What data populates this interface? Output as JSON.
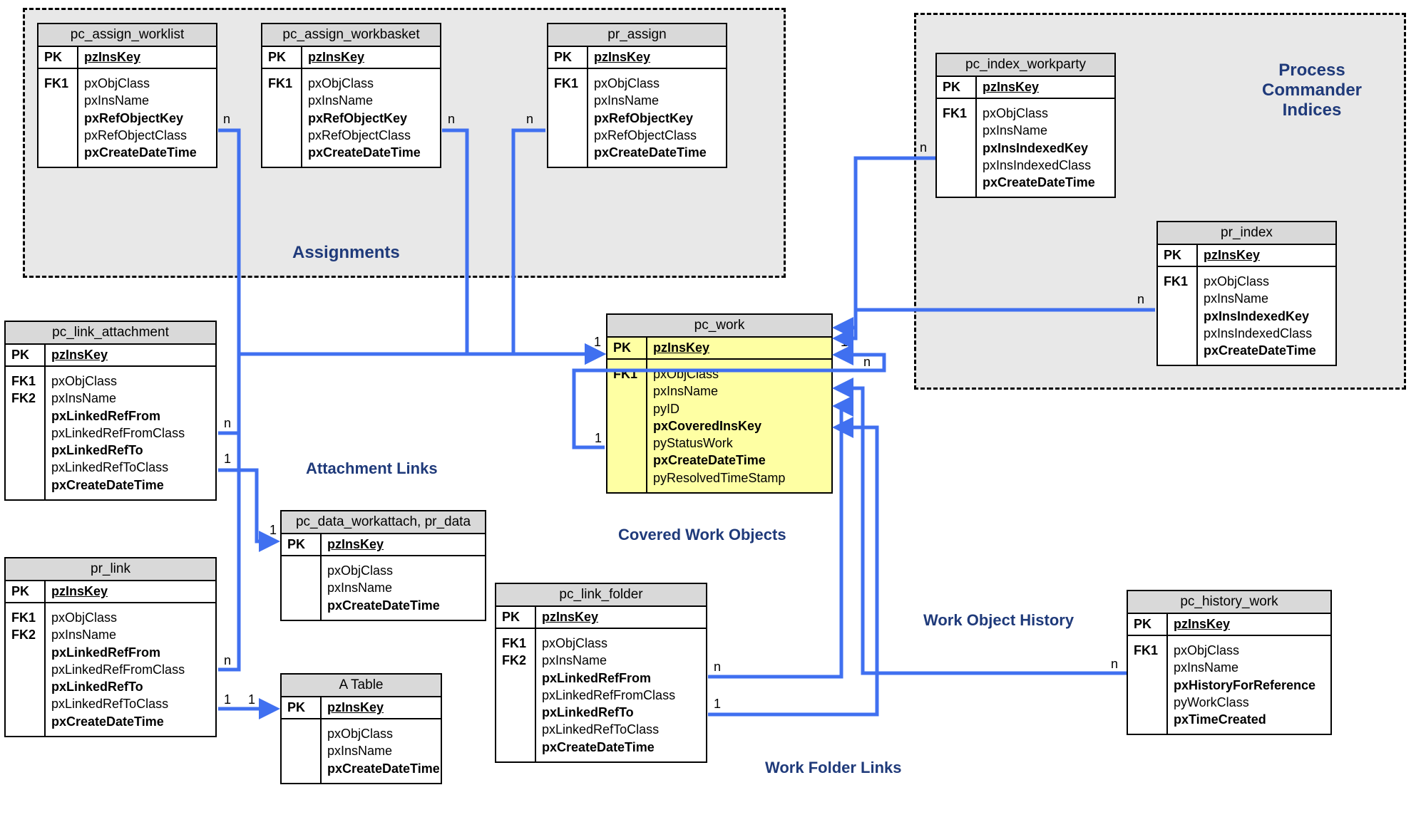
{
  "groups": {
    "assignments_label": "Assignments",
    "indices_label_l1": "Process Commander",
    "indices_label_l2": "Indices"
  },
  "labels": {
    "attachment_links": "Attachment Links",
    "covered_work_objects": "Covered Work Objects",
    "work_object_history": "Work Object History",
    "work_folder_links": "Work Folder Links"
  },
  "entities": {
    "pc_assign_worklist": {
      "title": "pc_assign_worklist",
      "pk": "pzInsKey",
      "keys": "\n\nFK1",
      "fields": "pxObjClass\npxInsName\npxRefObjectKey\npxRefObjectClass\npxCreateDateTime",
      "bold_fields": [
        2,
        4
      ]
    },
    "pc_assign_workbasket": {
      "title": "pc_assign_workbasket",
      "pk": "pzInsKey",
      "keys": "\n\nFK1",
      "fields": "pxObjClass\npxInsName\npxRefObjectKey\npxRefObjectClass\npxCreateDateTime",
      "bold_fields": [
        2,
        4
      ]
    },
    "pr_assign": {
      "title": "pr_assign",
      "pk": "pzInsKey",
      "keys": "\n\nFK1",
      "fields": "pxObjClass\npxInsName\npxRefObjectKey\npxRefObjectClass\npxCreateDateTime",
      "bold_fields": [
        2,
        4
      ]
    },
    "pc_index_workparty": {
      "title": "pc_index_workparty",
      "pk": "pzInsKey",
      "keys": "\n\nFK1",
      "fields": "pxObjClass\npxInsName\npxInsIndexedKey\npxInsIndexedClass\npxCreateDateTime",
      "bold_fields": [
        2,
        4
      ]
    },
    "pr_index": {
      "title": "pr_index",
      "pk": "pzInsKey",
      "keys": "\n\nFK1",
      "fields": "pxObjClass\npxInsName\npxInsIndexedKey\npxInsIndexedClass\npxCreateDateTime",
      "bold_fields": [
        2,
        4
      ]
    },
    "pc_link_attachment": {
      "title": "pc_link_attachment",
      "pk": "pzInsKey",
      "keys": "\n\nFK1\n\nFK2",
      "fields": "pxObjClass\npxInsName\npxLinkedRefFrom\npxLinkedRefFromClass\npxLinkedRefTo\npxLinkedRefToClass\npxCreateDateTime",
      "bold_fields": [
        2,
        4,
        6
      ]
    },
    "pc_work": {
      "title": "pc_work",
      "pk": "pzInsKey",
      "keys": "\n\n\nFK1",
      "fields": "pxObjClass\npxInsName\npyID\npxCoveredInsKey\npyStatusWork\npxCreateDateTime\npyResolvedTimeStamp",
      "bold_fields": [
        3,
        5
      ]
    },
    "pr_link": {
      "title": "pr_link",
      "pk": "pzInsKey",
      "keys": "\n\nFK1\n\nFK2",
      "fields": "pxObjClass\npxInsName\npxLinkedRefFrom\npxLinkedRefFromClass\npxLinkedRefTo\npxLinkedRefToClass\npxCreateDateTime",
      "bold_fields": [
        2,
        4,
        6
      ]
    },
    "pc_data_workattach": {
      "title": "pc_data_workattach, pr_data",
      "pk": "pzInsKey",
      "keys": "",
      "fields": "pxObjClass\npxInsName\npxCreateDateTime",
      "bold_fields": [
        2
      ]
    },
    "a_table": {
      "title": "A Table",
      "pk": "pzInsKey",
      "keys": "",
      "fields": "pxObjClass\npxInsName\npxCreateDateTime",
      "bold_fields": [
        2
      ]
    },
    "pc_link_folder": {
      "title": "pc_link_folder",
      "pk": "pzInsKey",
      "keys": "\n\nFK1\n\nFK2",
      "fields": "pxObjClass\npxInsName\npxLinkedRefFrom\npxLinkedRefFromClass\npxLinkedRefTo\npxLinkedRefToClass\npxCreateDateTime",
      "bold_fields": [
        2,
        4,
        6
      ]
    },
    "pc_history_work": {
      "title": "pc_history_work",
      "pk": "pzInsKey",
      "keys": "\n\nFK1",
      "fields": "pxObjClass\npxInsName\npxHistoryForReference\npyWorkClass\npxTimeCreated",
      "bold_fields": [
        2,
        4
      ]
    }
  },
  "cardinalities": {
    "n": "n",
    "one": "1"
  }
}
